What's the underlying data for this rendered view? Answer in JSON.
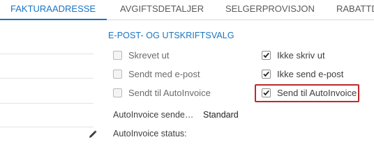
{
  "tabs": [
    {
      "label": "FAKTURAADRESSE",
      "active": true
    },
    {
      "label": "AVGIFTSDETALJER",
      "active": false
    },
    {
      "label": "SELGERPROVISJON",
      "active": false
    },
    {
      "label": "RABATTD",
      "active": false
    }
  ],
  "section": {
    "title": "E-POST- OG UTSKRIFTSVALG"
  },
  "checkboxes": {
    "skrevet_ut": {
      "label": "Skrevet ut",
      "checked": false
    },
    "sendt_epost": {
      "label": "Sendt med e-post",
      "checked": false
    },
    "sendt_autoinvoice": {
      "label": "Sendt til AutoInvoice",
      "checked": false
    },
    "ikke_skriv_ut": {
      "label": "Ikke skriv ut",
      "checked": true
    },
    "ikke_send_epost": {
      "label": "Ikke send e-post",
      "checked": true
    },
    "send_autoinvoice": {
      "label": "Send til AutoInvoice",
      "checked": true
    }
  },
  "fields": {
    "autoinvoice_sende": {
      "label": "AutoInvoice sende…",
      "value": "Standard"
    },
    "autoinvoice_status": {
      "label": "AutoInvoice status:",
      "value": ""
    }
  },
  "colors": {
    "accent": "#1a74c3",
    "highlight": "#c0272d"
  },
  "icons": {
    "edit": "pencil-icon",
    "check": "checkmark-icon"
  }
}
